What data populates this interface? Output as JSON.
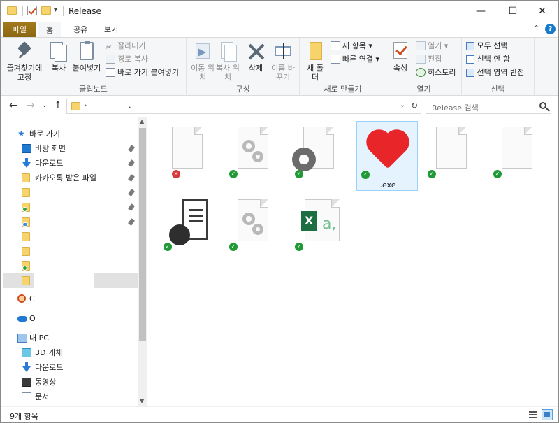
{
  "window": {
    "title": "Release",
    "minimize_glyph": "—",
    "maximize_glyph": "☐",
    "close_glyph": "✕"
  },
  "ribbon_tabs": [
    {
      "label": "파일"
    },
    {
      "label": "홈"
    },
    {
      "label": "공유"
    },
    {
      "label": "보기"
    }
  ],
  "ribbon": {
    "clipboard": {
      "label": "클립보드",
      "pin": "즐겨찾기에 고정",
      "copy": "복사",
      "paste": "붙여넣기",
      "cut": "잘라내기",
      "copy_path": "경로 복사",
      "paste_shortcut": "바로 가기 붙여넣기"
    },
    "organize": {
      "label": "구성",
      "move": "이동 위치",
      "copy_to": "복사 위치",
      "delete": "삭제",
      "rename": "이름 바꾸기"
    },
    "new": {
      "label": "새로 만들기",
      "new_folder": "새 폴더",
      "new_item": "새 항목",
      "easy_access": "빠른 연결"
    },
    "open": {
      "label": "열기",
      "properties": "속성",
      "open": "열기",
      "edit": "편집",
      "history": "히스토리"
    },
    "select": {
      "label": "선택",
      "select_all": "모두 선택",
      "select_none": "선택 안 함",
      "invert": "선택 영역 반전"
    }
  },
  "address": {
    "separator": "›",
    "path_tail": ".",
    "search_placeholder": "Release 검색"
  },
  "nav": {
    "quick_access": "바로 가기",
    "items": [
      {
        "label": "바탕 화면"
      },
      {
        "label": "다운로드"
      },
      {
        "label": "카카오톡 받은 파일"
      }
    ],
    "c_label": "C",
    "o_label": "O",
    "this_pc": "내 PC",
    "pc_items": [
      {
        "label": "3D 개체"
      },
      {
        "label": "다운로드"
      },
      {
        "label": "동영상"
      },
      {
        "label": "문서"
      }
    ]
  },
  "files": [
    {
      "type": "blank",
      "status": "error",
      "label": ""
    },
    {
      "type": "config",
      "status": "ok",
      "label": ""
    },
    {
      "type": "settings",
      "status": "ok",
      "label": ""
    },
    {
      "type": "heart",
      "status": "ok",
      "label": ".exe"
    },
    {
      "type": "blank",
      "status": "ok",
      "label": ""
    },
    {
      "type": "blank",
      "status": "ok",
      "label": ""
    },
    {
      "type": "report",
      "status": "ok",
      "label": ""
    },
    {
      "type": "config",
      "status": "ok",
      "label": ""
    },
    {
      "type": "excel",
      "status": "ok",
      "label": ""
    }
  ],
  "status_bar": {
    "count": "9개 항목"
  }
}
